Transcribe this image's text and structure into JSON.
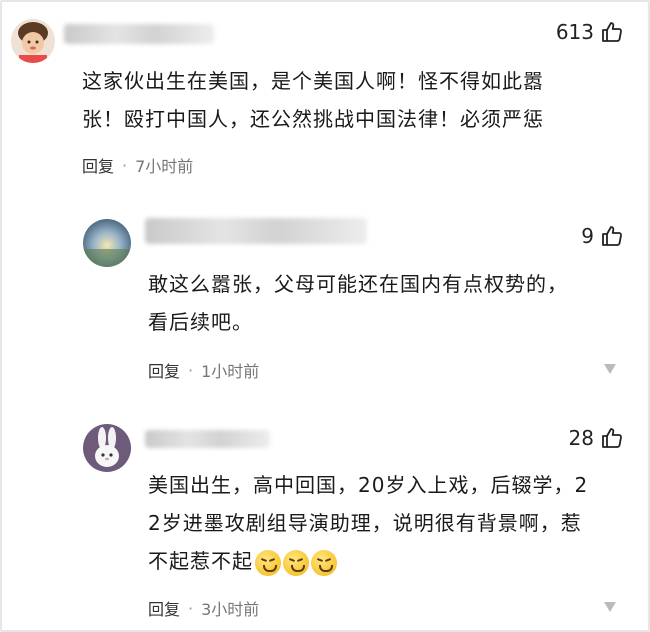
{
  "comments": [
    {
      "likes": "613",
      "text_lines": [
        "这家伙出生在美国，是个美国人啊！怪不得如此嚣",
        "张！殴打中国人，还公然挑战中国法律！必须严惩"
      ],
      "reply_label": "回复",
      "separator": "·",
      "time": "7小时前"
    },
    {
      "likes": "9",
      "text_lines": [
        "敢这么嚣张，父母可能还在国内有点权势的，",
        "看后续吧。"
      ],
      "reply_label": "回复",
      "separator": "·",
      "time": "1小时前"
    },
    {
      "likes": "28",
      "text_lines": [
        "美国出生，高中回国，20岁入上戏，后辍学，2",
        "2岁进墨攻剧组导演助理，说明很有背景啊，惹",
        "不起惹不起"
      ],
      "emoji_count": 3,
      "reply_label": "回复",
      "separator": "·",
      "time": "3小时前"
    }
  ],
  "icons": {
    "like": "thumbs-up-icon",
    "more": "more-dots-icon"
  }
}
